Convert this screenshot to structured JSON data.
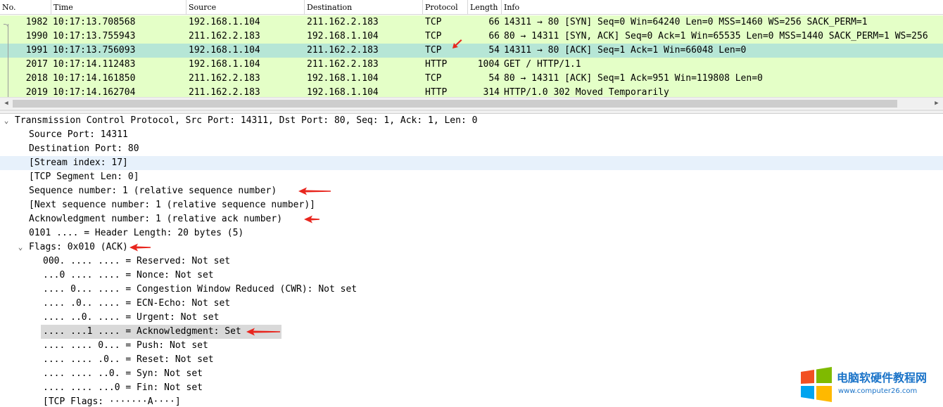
{
  "packet_list": {
    "columns": [
      "No.",
      "Time",
      "Source",
      "Destination",
      "Protocol",
      "Length",
      "Info"
    ],
    "rows": [
      {
        "no": "1982",
        "time": "10:17:13.708568",
        "source": "192.168.1.104",
        "destination": "211.162.2.183",
        "protocol": "TCP",
        "length": "66",
        "info": "14311 → 80 [SYN] Seq=0 Win=64240 Len=0 MSS=1460 WS=256 SACK_PERM=1"
      },
      {
        "no": "1990",
        "time": "10:17:13.755943",
        "source": "211.162.2.183",
        "destination": "192.168.1.104",
        "protocol": "TCP",
        "length": "66",
        "info": "80 → 14311 [SYN, ACK] Seq=0 Ack=1 Win=65535 Len=0 MSS=1440 SACK_PERM=1 WS=256"
      },
      {
        "no": "1991",
        "time": "10:17:13.756093",
        "source": "192.168.1.104",
        "destination": "211.162.2.183",
        "protocol": "TCP",
        "length": "54",
        "info": "14311 → 80 [ACK] Seq=1 Ack=1 Win=66048 Len=0",
        "selected": true
      },
      {
        "no": "2017",
        "time": "10:17:14.112483",
        "source": "192.168.1.104",
        "destination": "211.162.2.183",
        "protocol": "HTTP",
        "length": "1004",
        "info": "GET / HTTP/1.1"
      },
      {
        "no": "2018",
        "time": "10:17:14.161850",
        "source": "211.162.2.183",
        "destination": "192.168.1.104",
        "protocol": "TCP",
        "length": "54",
        "info": "80 → 14311 [ACK] Seq=1 Ack=951 Win=119808 Len=0"
      },
      {
        "no": "2019",
        "time": "10:17:14.162704",
        "source": "211.162.2.183",
        "destination": "192.168.1.104",
        "protocol": "HTTP",
        "length": "314",
        "info": "HTTP/1.0 302 Moved Temporarily"
      }
    ],
    "row_color": "#e4ffc7",
    "selected_color": "#b6e6d6"
  },
  "details": {
    "lines": [
      {
        "text": "Transmission Control Protocol, Src Port: 14311, Dst Port: 80, Seq: 1, Ack: 1, Len: 0",
        "indent": 0,
        "expander": "expanded"
      },
      {
        "text": "Source Port: 14311",
        "indent": 1
      },
      {
        "text": "Destination Port: 80",
        "indent": 1
      },
      {
        "text": "[Stream index: 17]",
        "indent": 1,
        "highlight": "blue"
      },
      {
        "text": "[TCP Segment Len: 0]",
        "indent": 1
      },
      {
        "text": "Sequence number: 1    (relative sequence number)",
        "indent": 1,
        "arrow": true
      },
      {
        "text": "[Next sequence number: 1    (relative sequence number)]",
        "indent": 1
      },
      {
        "text": "Acknowledgment number: 1    (relative ack number)",
        "indent": 1,
        "arrow": true
      },
      {
        "text": "0101 .... = Header Length: 20 bytes (5)",
        "indent": 1
      },
      {
        "text": "Flags: 0x010 (ACK)",
        "indent": 1,
        "expander": "expanded",
        "arrow": true
      },
      {
        "text": "000. .... .... = Reserved: Not set",
        "indent": 2
      },
      {
        "text": "...0 .... .... = Nonce: Not set",
        "indent": 2
      },
      {
        "text": ".... 0... .... = Congestion Window Reduced (CWR): Not set",
        "indent": 2
      },
      {
        "text": ".... .0.. .... = ECN-Echo: Not set",
        "indent": 2
      },
      {
        "text": ".... ..0. .... = Urgent: Not set",
        "indent": 2
      },
      {
        "text": ".... ...1 .... = Acknowledgment: Set",
        "indent": 2,
        "highlight": "gray",
        "arrow": true
      },
      {
        "text": ".... .... 0... = Push: Not set",
        "indent": 2
      },
      {
        "text": ".... .... .0.. = Reset: Not set",
        "indent": 2
      },
      {
        "text": ".... .... ..0. = Syn: Not set",
        "indent": 2
      },
      {
        "text": ".... .... ...0 = Fin: Not set",
        "indent": 2
      },
      {
        "text": "[TCP Flags: ·······A····]",
        "indent": 2
      }
    ]
  },
  "annotation_color": "#e8261e",
  "watermark": {
    "title": "电脑软硬件教程网",
    "url": "www.computer26.com"
  }
}
